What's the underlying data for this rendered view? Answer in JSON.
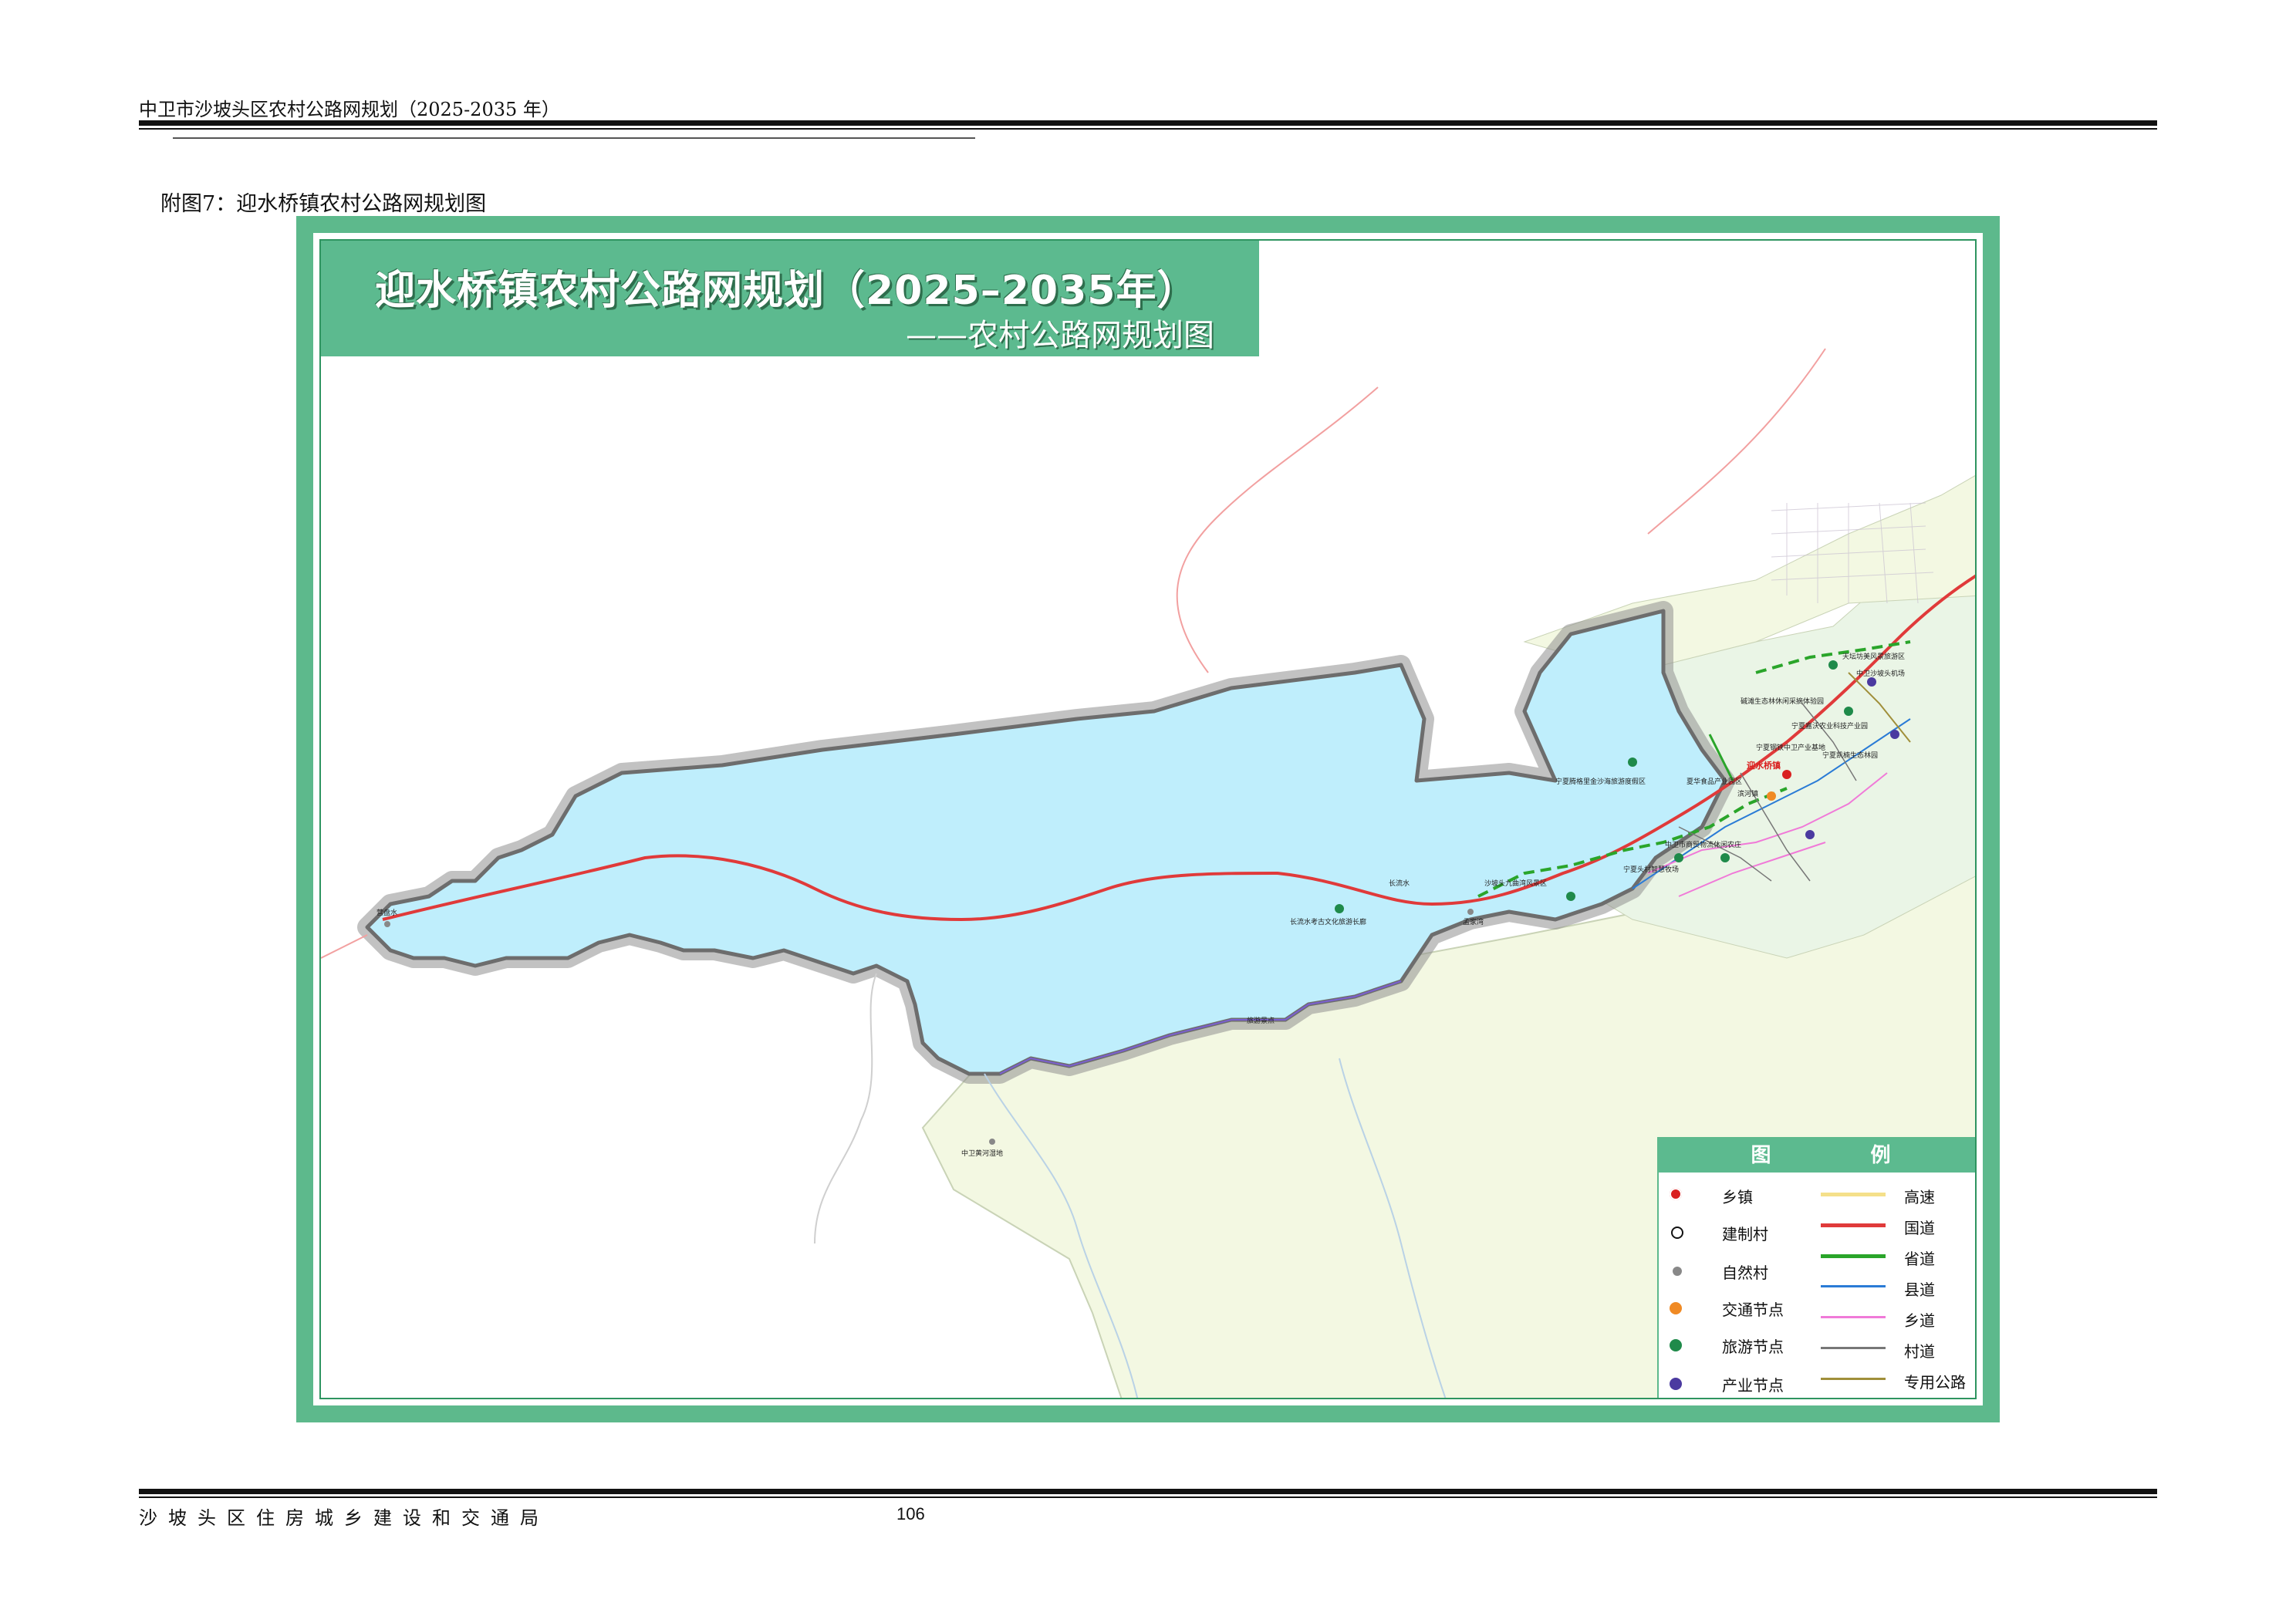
{
  "header": {
    "title": "中卫市沙坡头区农村公路网规划（2025-2035 年）"
  },
  "figure": {
    "caption": "附图7：迎水桥镇农村公路网规划图"
  },
  "map": {
    "title": "迎水桥镇农村公路网规划（2025–2035年）",
    "subtitle": "——农村公路网规划图",
    "colors": {
      "frame": "#5db98c",
      "study_area": "#bfeefc",
      "outside_land": "#f3f8e2",
      "study_border": "#8a8a8a"
    },
    "labels": {
      "town": "迎水桥镇",
      "l1": "天坛坊美风景旅游区",
      "l2": "中卫沙坡头机场",
      "l3": "碱滩生态林休闲采摘体验园",
      "l4": "宁夏嘉沃农业科技产业园",
      "l5": "宁夏凯楠生态林园",
      "l6": "宁夏钢铁中卫产业基地",
      "l7": "宁夏腾格里金沙海旅游度假区",
      "l8": "夏华食品产业园区",
      "l9": "滨河镇",
      "l10": "中卫市商贸物流休闲农庄",
      "l11": "沙坡头九曲湾风景区",
      "l12": "宁夏头村智慧牧场",
      "l13": "长流水考古文化旅游长廊",
      "l14": "孟家湾",
      "l15": "长流水",
      "l16": "营盘水",
      "l17": "中卫黄河湿地",
      "l18": "旅游景点"
    },
    "legend": {
      "title": "图   例",
      "points": [
        {
          "label": "乡镇",
          "icon": "town-icon",
          "color": "#d92020"
        },
        {
          "label": "建制村",
          "icon": "admin-village-icon",
          "color": "#111111"
        },
        {
          "label": "自然村",
          "icon": "natural-village-icon",
          "color": "#888888"
        },
        {
          "label": "交通节点",
          "icon": "traffic-node-icon",
          "color": "#f08a24"
        },
        {
          "label": "旅游节点",
          "icon": "tourism-node-icon",
          "color": "#1f8a4a"
        },
        {
          "label": "产业节点",
          "icon": "industry-node-icon",
          "color": "#4b3aa0"
        }
      ],
      "lines": [
        {
          "label": "高速",
          "color": "#f5e08a"
        },
        {
          "label": "国道",
          "color": "#e03a3a"
        },
        {
          "label": "省道",
          "color": "#2aa52a"
        },
        {
          "label": "县道",
          "color": "#2a7bd6"
        },
        {
          "label": "乡道",
          "color": "#f07ad8"
        },
        {
          "label": "村道",
          "color": "#777777"
        },
        {
          "label": "专用公路",
          "color": "#a08f3a"
        }
      ]
    }
  },
  "footer": {
    "org": "沙坡头区住房城乡建设和交通局",
    "page": "106"
  }
}
